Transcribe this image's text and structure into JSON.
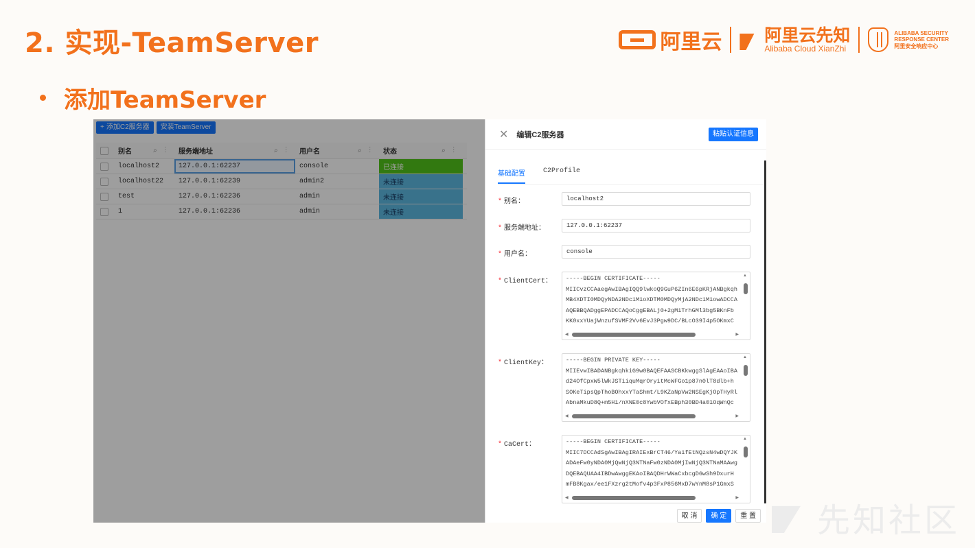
{
  "slide": {
    "title": "2. 实现-TeamServer",
    "bullet": "添加TeamServer",
    "logos": {
      "aliyun": "阿里云",
      "xianzhi_cn": "阿里云先知",
      "xianzhi_en": "Alibaba Cloud XianZhi",
      "asrc_line1": "ALIBABA SECURITY",
      "asrc_line2": "RESPONSE CENTER",
      "asrc_line3": "阿里安全响应中心"
    },
    "watermark": "先知社区"
  },
  "list": {
    "add_button": "添加C2服务器",
    "install_button": "安装TeamServer",
    "columns": [
      "别名",
      "服务端地址",
      "用户名",
      "状态"
    ],
    "rows": [
      {
        "alias": "localhost2",
        "address": "127.0.0.1:62237",
        "user": "console",
        "status": "已连接"
      },
      {
        "alias": "localhost22",
        "address": "127.0.0.1:62239",
        "user": "admin2",
        "status": "未连接"
      },
      {
        "alias": "test",
        "address": "127.0.0.1:62236",
        "user": "admin",
        "status": "未连接"
      },
      {
        "alias": "1",
        "address": "127.0.0.1:62236",
        "user": "admin",
        "status": "未连接"
      }
    ]
  },
  "drawer": {
    "title": "编辑C2服务器",
    "paste_button": "粘贴认证信息",
    "tabs": [
      "基础配置",
      "C2Profile"
    ],
    "fields": {
      "alias_label": "别名：",
      "alias_value": "localhost2",
      "address_label": "服务端地址：",
      "address_value": "127.0.0.1:62237",
      "user_label": "用户名：",
      "user_value": "console",
      "clientcert_label": "ClientCert：",
      "clientcert_value": "-----BEGIN CERTIFICATE-----\nMIICvzCCAaegAwIBAgIQQ9lwkoQ9GuP6ZIn6E6pKRjANBgkqh\nMB4XDTI0MDQyNDA2NDc1M1oXDTM0MDQyMjA2NDc1M1owADCCA\nAQEBBQADggEPADCCAQoCggEBALj0+2gMiTrhGMl3bg5BKnFb\nKK0xxYUajWnzufSVMF2Vv6EvJ3Pgw9DC/BLcO39I4p5OKmxC",
      "clientkey_label": "ClientKey：",
      "clientkey_value": "-----BEGIN PRIVATE KEY-----\nMIIEvwIBADANBgkqhkiG9w0BAQEFAASCBKkwggSlAgEAAoIBA\nd24OfCpxW5lWkJSTiiquMqrOryitMcWFGo1p87n0lT8dlb+h\nSOKeTipsQpThoBOhxxYTaShmt/L9KZaNpVw2NSEgKjOpTHyRl\nAbnaMkuD8Q+m5Hi/nXNE0c8YwbVOfxEBph30BD4a01OqWnQc",
      "cacert_label": "CaCert：",
      "cacert_value": "-----BEGIN CERTIFICATE-----\nMIIC7DCCAdSgAwIBAgIRAIExBrCT46/YaifEtNQzsN4wDQYJK\nADAeFw0yNDA0MjQwNjQ3NTNaFw0zNDA0MjIwNjQ3NTNaMAAwg\nDQEBAQUAA4IBDwAwggEKAoIBAQDHrWWaCxbcgD6wSh9DxurH\nmFB8Kgax/ee1FXzrg2tMofv4p3FxP856MxD7wYnM8sP1GmxS"
    },
    "footer": {
      "cancel": "取 消",
      "ok": "确 定",
      "reset": "重 置"
    }
  }
}
